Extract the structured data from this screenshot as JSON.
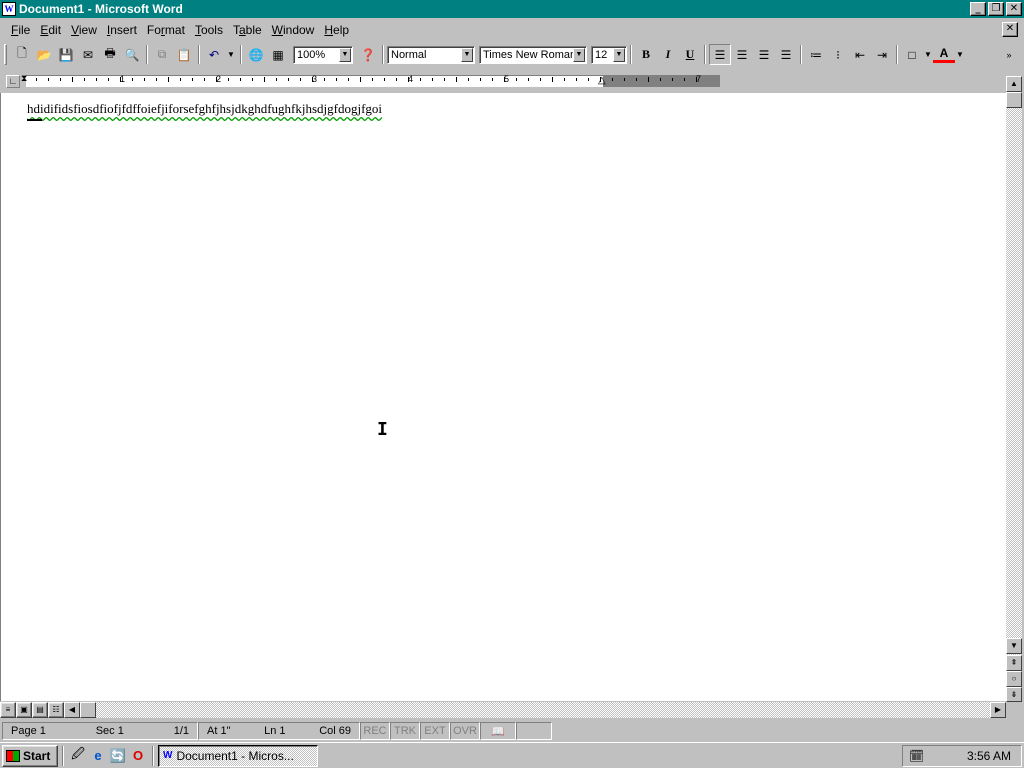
{
  "window": {
    "title": "Document1 - Microsoft Word",
    "icon": "word-doc-icon"
  },
  "menu": [
    "File",
    "Edit",
    "View",
    "Insert",
    "Format",
    "Tools",
    "Table",
    "Window",
    "Help"
  ],
  "menu_underline": [
    "F",
    "E",
    "V",
    "I",
    "r",
    "T",
    "a",
    "W",
    "H"
  ],
  "toolbar": {
    "zoom": "100%",
    "style": "Normal",
    "font": "Times New Roman",
    "size": "12",
    "bold": "B",
    "italic": "I",
    "underline": "U"
  },
  "ruler": {
    "numbers": [
      "1",
      "2",
      "3",
      "4",
      "5",
      "7"
    ]
  },
  "document": {
    "text": "hdidifidsfiosdfiofjfdffoiefjiforsefghfjhsjdkghdfughfkjhsdjgfdogjfgoi"
  },
  "status": {
    "page": "Page 1",
    "sec": "Sec 1",
    "pages": "1/1",
    "at": "At 1\"",
    "ln": "Ln 1",
    "col": "Col 69",
    "rec": "REC",
    "trk": "TRK",
    "ext": "EXT",
    "ovr": "OVR"
  },
  "taskbar": {
    "start": "Start",
    "task": "Document1 - Micros...",
    "clock": "3:56 AM"
  }
}
